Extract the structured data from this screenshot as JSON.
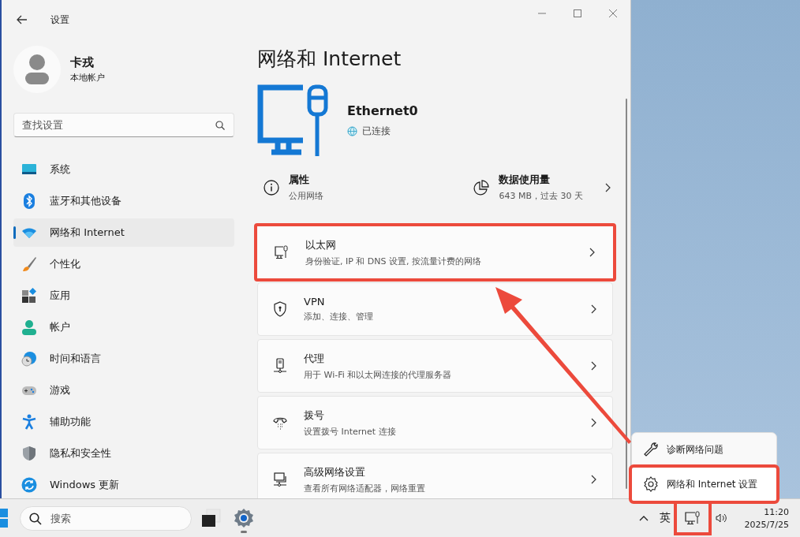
{
  "window": {
    "title": "设置"
  },
  "profile": {
    "name": "卡戎",
    "account_type": "本地帐户"
  },
  "search": {
    "placeholder": "查找设置"
  },
  "nav_items": [
    {
      "label": "系统",
      "selected": false
    },
    {
      "label": "蓝牙和其他设备",
      "selected": false
    },
    {
      "label": "网络和 Internet",
      "selected": true
    },
    {
      "label": "个性化",
      "selected": false
    },
    {
      "label": "应用",
      "selected": false
    },
    {
      "label": "帐户",
      "selected": false
    },
    {
      "label": "时间和语言",
      "selected": false
    },
    {
      "label": "游戏",
      "selected": false
    },
    {
      "label": "辅助功能",
      "selected": false
    },
    {
      "label": "隐私和安全性",
      "selected": false
    },
    {
      "label": "Windows 更新",
      "selected": false
    }
  ],
  "page_title": "网络和 Internet",
  "adapter": {
    "name": "Ethernet0",
    "status": "已连接"
  },
  "properties": {
    "title": "属性",
    "subtitle": "公用网络"
  },
  "data_usage": {
    "title": "数据使用量",
    "subtitle": "643 MB，过去 30 天"
  },
  "cards": [
    {
      "title": "以太网",
      "subtitle": "身份验证, IP 和 DNS 设置, 按流量计费的网络",
      "highlighted": true
    },
    {
      "title": "VPN",
      "subtitle": "添加、连接、管理",
      "highlighted": false
    },
    {
      "title": "代理",
      "subtitle": "用于 Wi-Fi 和以太网连接的代理服务器",
      "highlighted": false
    },
    {
      "title": "拨号",
      "subtitle": "设置拨号 Internet 连接",
      "highlighted": false
    },
    {
      "title": "高级网络设置",
      "subtitle": "查看所有网络适配器，网络重置",
      "highlighted": false
    }
  ],
  "context_menu": [
    {
      "label": "诊断网络问题",
      "highlighted": false
    },
    {
      "label": "网络和 Internet 设置",
      "highlighted": true
    }
  ],
  "taskbar": {
    "search_placeholder": "搜索",
    "ime": "英",
    "network_highlighted": true,
    "time": "11:20",
    "date": "2025/7/25"
  }
}
